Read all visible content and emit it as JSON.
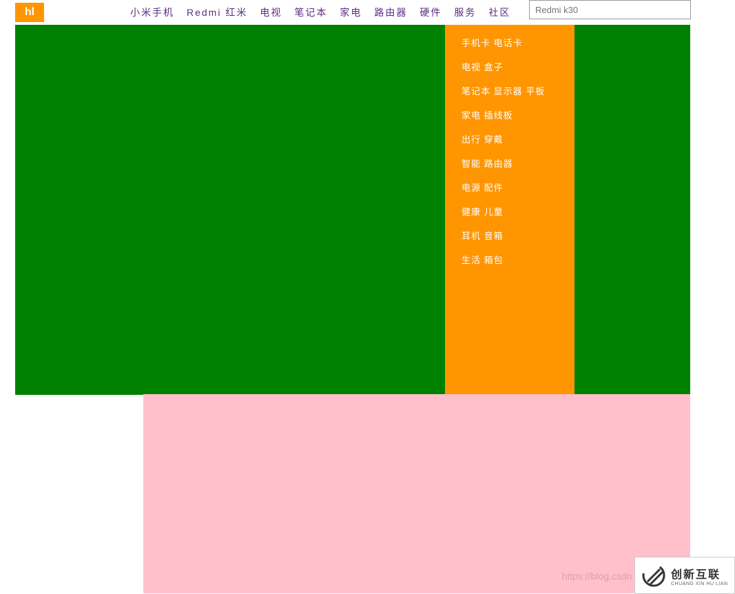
{
  "logo": {
    "text": "hl"
  },
  "nav": {
    "items": [
      "小米手机",
      "Redmi 红米",
      "电视",
      "笔记本",
      "家电",
      "路由器",
      "硬件",
      "服务",
      "社区"
    ]
  },
  "search": {
    "placeholder": "Redmi k30"
  },
  "sidebar": {
    "items": [
      "手机卡 电话卡",
      "电视 盒子",
      "笔记本 显示器 平板",
      "家电 插线板",
      "出行 穿戴",
      "智能 路由器",
      "电源 配件",
      "健康 儿童",
      "耳机 音箱",
      "生活 箱包"
    ]
  },
  "watermark": {
    "text": "https://blog.csdn.ne"
  },
  "corner": {
    "cn": "创新互联",
    "en": "CHUANG XIN HU LIAN"
  }
}
